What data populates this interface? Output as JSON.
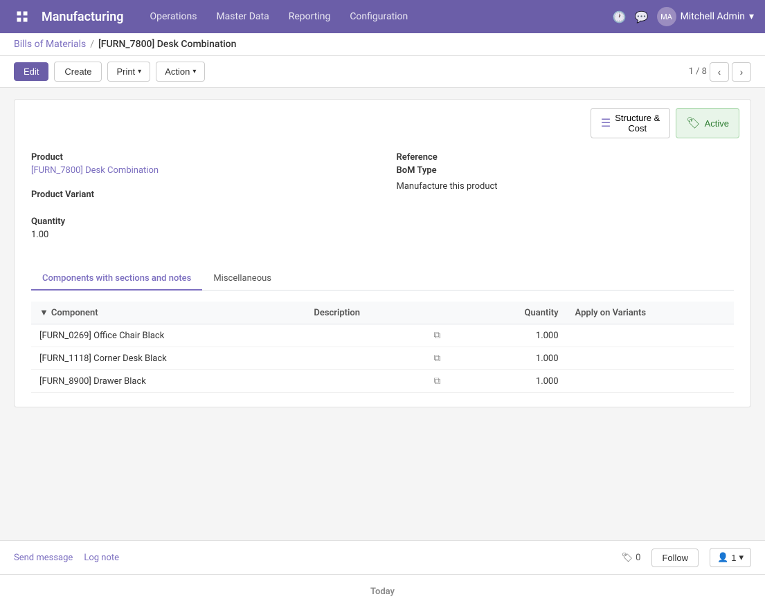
{
  "app": {
    "name": "Manufacturing",
    "icon": "grid"
  },
  "nav": {
    "links": [
      "Operations",
      "Master Data",
      "Reporting",
      "Configuration"
    ],
    "user": "Mitchell Admin",
    "user_short": "MA"
  },
  "breadcrumb": {
    "parent": "Bills of Materials",
    "separator": "/",
    "current": "[FURN_7800] Desk Combination"
  },
  "toolbar": {
    "edit_label": "Edit",
    "create_label": "Create",
    "print_label": "Print",
    "action_label": "Action",
    "pagination": "1 / 8"
  },
  "status_buttons": {
    "structure_cost": "Structure &\nCost",
    "structure_icon": "☰",
    "active": "Active",
    "active_icon": "✓"
  },
  "form": {
    "product_label": "Product",
    "product_value": "[FURN_7800] Desk Combination",
    "variant_label": "Product Variant",
    "quantity_label": "Quantity",
    "quantity_value": "1.00",
    "reference_label": "Reference",
    "bom_type_label": "BoM Type",
    "bom_type_value": "Manufacture this product"
  },
  "tabs": [
    {
      "label": "Components with sections and notes",
      "active": true
    },
    {
      "label": "Miscellaneous",
      "active": false
    }
  ],
  "table": {
    "headers": [
      "Component",
      "Description",
      "",
      "Quantity",
      "Apply on Variants"
    ],
    "rows": [
      {
        "component": "[FURN_0269] Office Chair Black",
        "description": "",
        "quantity": "1.000"
      },
      {
        "component": "[FURN_1118] Corner Desk Black",
        "description": "",
        "quantity": "1.000"
      },
      {
        "component": "[FURN_8900] Drawer Black",
        "description": "",
        "quantity": "1.000"
      }
    ]
  },
  "chatter": {
    "send_message": "Send message",
    "log_note": "Log note",
    "tags_count": "0",
    "follow_label": "Follow",
    "followers_count": "1"
  },
  "today": {
    "label": "Today"
  }
}
